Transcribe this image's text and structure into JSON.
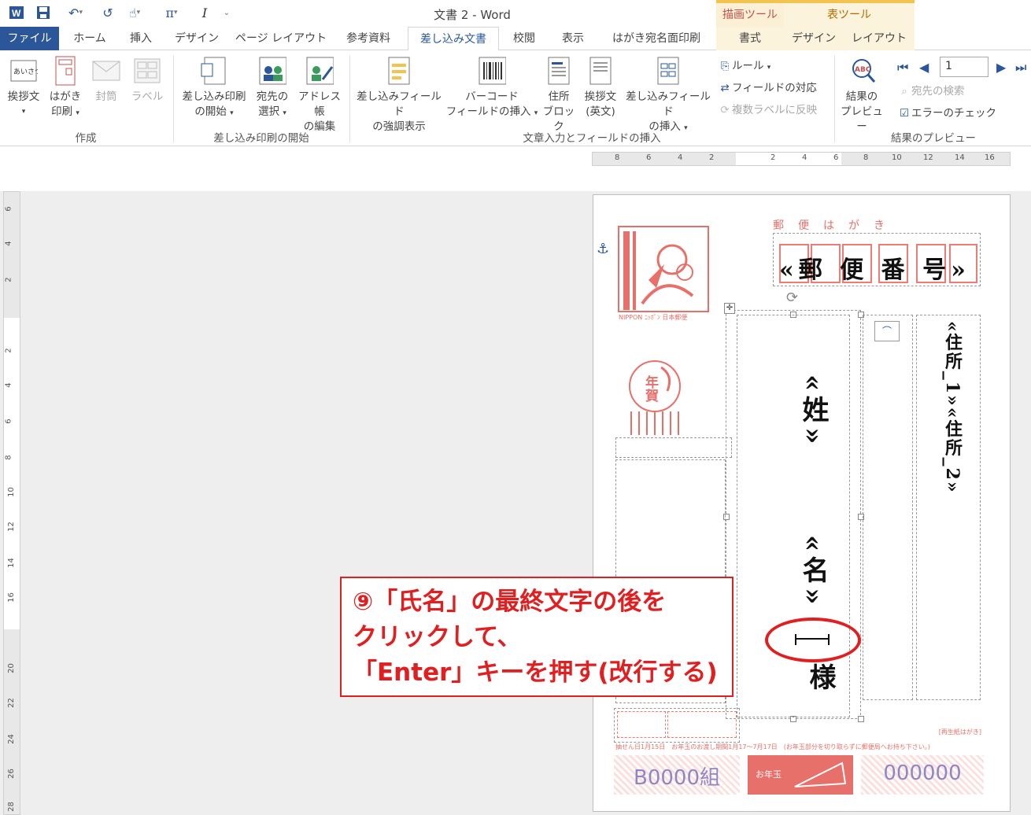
{
  "window": {
    "title": "文書 2 - Word"
  },
  "context_tabs": {
    "drawing_tools": "描画ツール",
    "table_tools": "表ツール"
  },
  "tabs": [
    {
      "label": "ファイル"
    },
    {
      "label": "ホーム"
    },
    {
      "label": "挿入"
    },
    {
      "label": "デザイン"
    },
    {
      "label": "ページ レイアウト"
    },
    {
      "label": "参考資料"
    },
    {
      "label": "差し込み文書"
    },
    {
      "label": "校閲"
    },
    {
      "label": "表示"
    },
    {
      "label": "はがき宛名面印刷"
    },
    {
      "label": "書式"
    },
    {
      "label": "デザイン"
    },
    {
      "label": "レイアウト"
    }
  ],
  "ribbon": {
    "groups": {
      "create": "作成",
      "start_merge": "差し込み印刷の開始",
      "write_insert": "文章入力とフィールドの挿入",
      "preview": "結果のプレビュー"
    },
    "buttons": {
      "greeting_doc": "挨拶文",
      "postcard_print_1": "はがき",
      "postcard_print_2": "印刷",
      "envelope": "封筒",
      "labels": "ラベル",
      "start_merge_1": "差し込み印刷",
      "start_merge_2": "の開始",
      "select_recipients_1": "宛先の",
      "select_recipients_2": "選択",
      "edit_list_1": "アドレス帳",
      "edit_list_2": "の編集",
      "highlight_fields_1": "差し込みフィールド",
      "highlight_fields_2": "の強調表示",
      "barcode_1": "バーコード",
      "barcode_2": "フィールドの挿入",
      "address_block_1": "住所",
      "address_block_2": "ブロック",
      "greeting_line_1": "挨拶文",
      "greeting_line_2": "(英文)",
      "insert_field_1": "差し込みフィールド",
      "insert_field_2": "の挿入",
      "rules": "ルール",
      "match_fields": "フィールドの対応",
      "update_labels": "複数ラベルに反映",
      "preview_results_1": "結果の",
      "preview_results_2": "プレビュー",
      "find_recipient": "宛先の検索",
      "check_errors": "エラーのチェック",
      "record_number": "1",
      "greeting_icon_text": "あいさつ",
      "abc_icon_text": "ABC"
    }
  },
  "ruler": {
    "top_marks": [
      "8",
      "6",
      "4",
      "2",
      "2",
      "4",
      "6",
      "8",
      "10",
      "12",
      "14",
      "16"
    ],
    "side_marks": [
      "6",
      "4",
      "2",
      "2",
      "4",
      "6",
      "8",
      "10",
      "12",
      "14",
      "16",
      "20",
      "22",
      "24",
      "26",
      "28"
    ]
  },
  "postcard": {
    "header": "郵便はがき",
    "zip_field": "«郵 便 番 号»",
    "address_field": "«住所_1»«住所_2»",
    "surname_field": "«姓»",
    "given_name_field": "«名»",
    "honorific": "様",
    "stamp_label": "NIPPON ﾆｯﾎﾟﾝ 日本郵便",
    "new_year_stamp": "年賀",
    "recycle_note": "[再生紙はがき]",
    "notice": "抽せん日1月15日　お年玉のお渡し期間1月17〜7月17日　(お年玉部分を切り取らずに郵便局へお持ち下さい。)",
    "lottery_group": "B0000組",
    "lottery_badge": "お年玉",
    "lottery_number": "000000"
  },
  "annotation": {
    "line1": "⑨「氏名」の最終文字の後を",
    "line2": "クリックして、",
    "line3": "「Enter」キーを押す(改行する)"
  },
  "colors": {
    "accent": "#2b579a",
    "postcard_red": "#e8706a",
    "callout_red": "#e02020",
    "lottery_purple": "#8f86c4"
  }
}
